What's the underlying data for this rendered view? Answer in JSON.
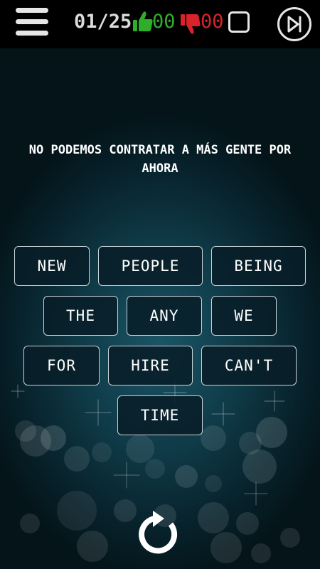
{
  "header": {
    "counter": "01/25",
    "likes": "00",
    "dislikes": "00"
  },
  "colors": {
    "like": "#2fae2a",
    "dislike": "#d8232a",
    "topbar": "#000000",
    "background": "#0f3a47"
  },
  "icons": {
    "menu": "hamburger-menu-icon",
    "like": "thumbs-up-icon",
    "dislike": "thumbs-down-icon",
    "checkbox": "checkbox-icon",
    "skip": "skip-forward-icon",
    "reset": "refresh-icon"
  },
  "prompt": "NO PODEMOS CONTRATAR A MÁS GENTE POR AHORA",
  "words": [
    "NEW",
    "PEOPLE",
    "BEING",
    "THE",
    "ANY",
    "WE",
    "FOR",
    "HIRE",
    "CAN'T",
    "TIME"
  ]
}
